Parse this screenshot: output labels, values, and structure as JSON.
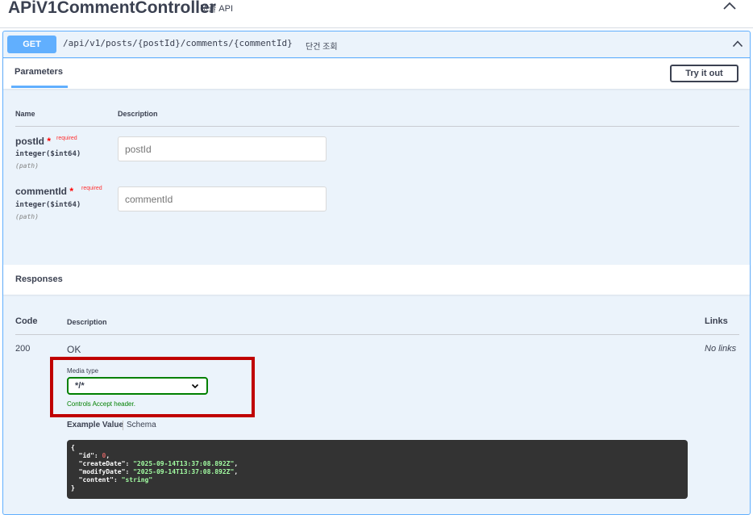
{
  "tag": {
    "name": "APiV1CommentController",
    "description": "댓글 API"
  },
  "operation": {
    "method": "GET",
    "path": "/api/v1/posts/{postId}/comments/{commentId}",
    "summary": "단건 조회"
  },
  "parameters": {
    "tab_label": "Parameters",
    "try_button": "Try it out",
    "col_name": "Name",
    "col_description": "Description",
    "items": [
      {
        "name": "postId",
        "star": "*",
        "required": "required",
        "type": "integer($int64)",
        "in": "(path)",
        "placeholder": "postId"
      },
      {
        "name": "commentId",
        "star": "*",
        "required": "required",
        "type": "integer($int64)",
        "in": "(path)",
        "placeholder": "commentId"
      }
    ]
  },
  "responses": {
    "title": "Responses",
    "col_code": "Code",
    "col_description": "Description",
    "col_links": "Links",
    "items": [
      {
        "code": "200",
        "description": "OK",
        "links": "No links",
        "media_type_label": "Media type",
        "media_type_value": "*/*",
        "media_hint": "Controls Accept header.",
        "tab_example": "Example Value",
        "tab_schema": "Schema",
        "example": {
          "open": "{",
          "id_key": "\"id\"",
          "id_val": "0",
          "createDate_key": "\"createDate\"",
          "createDate_val": "\"2025-09-14T13:37:08.892Z\"",
          "modifyDate_key": "\"modifyDate\"",
          "modifyDate_val": "\"2025-09-14T13:37:08.892Z\"",
          "content_key": "\"content\"",
          "content_val": "\"string\"",
          "close": "}"
        }
      }
    ]
  },
  "colors": {
    "get_accent": "#61affe",
    "highlight": "#c00000",
    "valid": "#008000"
  }
}
